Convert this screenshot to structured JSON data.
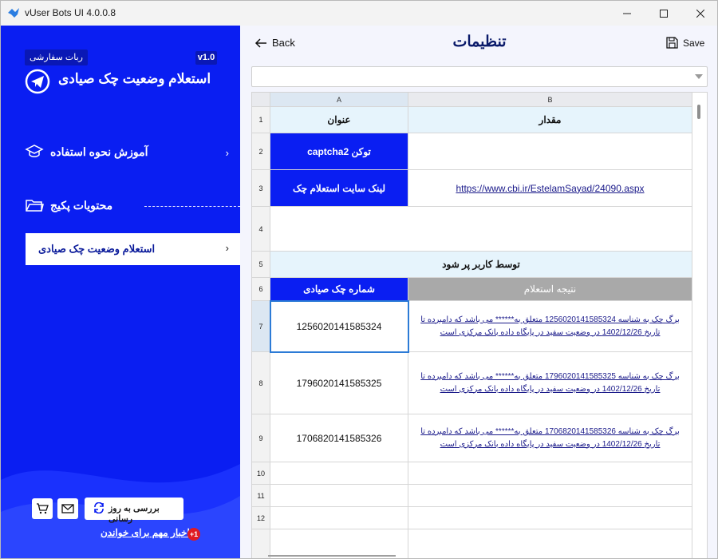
{
  "window": {
    "title": "vUser Bots UI 4.0.0.8"
  },
  "sidebar": {
    "custom_badge": "ربات سفارشی",
    "version": "v1.0",
    "bot_title": "استعلام وضعیت چک صیادی",
    "help_label": "آموزش نحوه استفاده",
    "package_label": "محتویات پکیج",
    "active_item": "استعلام وضعیت چک صیادی",
    "update_label": "بررسی به روز رسانی",
    "news_label": "اخبار مهم برای خواندن",
    "news_count": "+1"
  },
  "header": {
    "back_label": "Back",
    "title": "تنظیمات",
    "save_label": "Save"
  },
  "combo": {
    "value": ""
  },
  "grid": {
    "col_headers": [
      "A",
      "B"
    ],
    "row_numbers": [
      "1",
      "2",
      "3",
      "4",
      "5",
      "6",
      "7",
      "8",
      "9",
      "10",
      "11",
      "12"
    ],
    "r1": {
      "a": "عنوان",
      "b": "مقدار"
    },
    "r2": {
      "a": "captchaتوکن 2",
      "b": ""
    },
    "r3": {
      "a": "لینک سایت استعلام چک",
      "b": "https://www.cbi.ir/EstelamSayad/24090.aspx"
    },
    "r5": "توسط کاربر پر شود",
    "r6": {
      "a": "شماره چک صیادی",
      "b": "نتیجه استعلام"
    },
    "rows": [
      {
        "a": "1256020141585324",
        "b": "برگ چک به شناسه 1256020141585324 متعلق به****** می باشد که دامبرده تا تاریخ 1402/12/26 در وضعیت سفید در پایگاه داده بانک مرکزی است"
      },
      {
        "a": "1796020141585325",
        "b": "برگ چک به شناسه 1796020141585325 متعلق به****** می باشد که دامبرده تا تاریخ 1402/12/26 در وضعیت سفید در پایگاه داده بانک مرکزی است"
      },
      {
        "a": "1706820141585326",
        "b": "برگ چک به شناسه 1706820141585326 متعلق به****** می باشد که دامبرده تا تاریخ 1402/12/26 در وضعیت سفید در پایگاه داده بانک مرکزی است"
      }
    ]
  }
}
